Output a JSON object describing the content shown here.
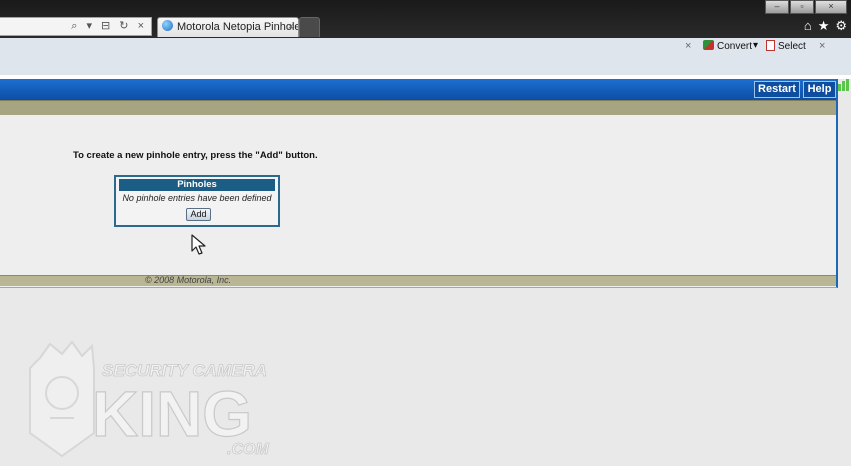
{
  "browser": {
    "tab_title": "Motorola Netopia Pinholes ...",
    "tab_close": "×",
    "address_tools": "⌕ ▾ ⊟ ↻ ×",
    "window_controls": {
      "minimize": "–",
      "restore": "▫",
      "close": "×"
    },
    "nav_icons": {
      "home": "⌂",
      "favorites": "★",
      "tools": "⚙"
    }
  },
  "toolbar": {
    "convert_label": "Convert",
    "convert_dropdown": "▾",
    "select_label": "Select",
    "close_glyph": "×"
  },
  "router": {
    "header_buttons": {
      "restart": "Restart",
      "help": "Help"
    },
    "instruction": "To create a new pinhole entry, press the \"Add\" button.",
    "pinholes": {
      "title": "Pinholes",
      "empty_message": "No pinhole entries have been defined",
      "add_button": "Add"
    },
    "footer": {
      "copyright": "© 2008 Motorola, Inc."
    }
  },
  "watermark": {
    "line1": "SECURITY CAMERA",
    "line2": "KING",
    "line3": ".COM"
  },
  "colors": {
    "header_blue": "#1565c0",
    "olive_bar": "#a7a482",
    "panel_title": "#1b5d85"
  }
}
